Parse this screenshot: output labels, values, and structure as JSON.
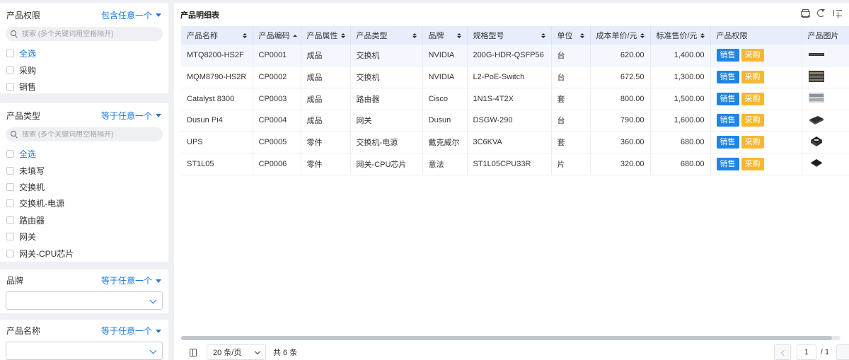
{
  "filters": {
    "permission": {
      "title": "产品权限",
      "operator": "包含任意一个",
      "search_placeholder": "搜索 (多个关键词用空格隔开)",
      "options": [
        "全选",
        "采购",
        "销售"
      ]
    },
    "type": {
      "title": "产品类型",
      "operator": "等于任意一个",
      "search_placeholder": "搜索 (多个关键词用空格隔开)",
      "options": [
        "全选",
        "未填写",
        "交换机",
        "交换机-电源",
        "路由器",
        "网关",
        "网关-CPU芯片"
      ]
    },
    "brand": {
      "title": "品牌",
      "operator": "等于任意一个",
      "value": ""
    },
    "name": {
      "title": "产品名称",
      "operator": "等于任意一个",
      "value": ""
    }
  },
  "table": {
    "title": "产品明细表",
    "columns": [
      "产品名称",
      "产品编码",
      "产品属性",
      "产品类型",
      "品牌",
      "规格型号",
      "单位",
      "成本单价/元",
      "标准售价/元",
      "产品权限",
      "产品图片"
    ],
    "permission_tags": {
      "sale": "销售",
      "buy": "采购"
    },
    "rows": [
      {
        "name": "MTQ8200-HS2F",
        "code": "CP0001",
        "attr": "成品",
        "type": "交换机",
        "brand": "NVIDIA",
        "spec": "200G-HDR-QSFP56",
        "unit": "台",
        "cost": "620.00",
        "price": "1,400.00",
        "image": "switch-thin-image"
      },
      {
        "name": "MQM8790-HS2R",
        "code": "CP0002",
        "attr": "成品",
        "type": "交换机",
        "brand": "NVIDIA",
        "spec": "L2-PoE-Switch",
        "unit": "台",
        "cost": "672.50",
        "price": "1,300.00",
        "image": "switch-ports-image"
      },
      {
        "name": "Catalyst 8300",
        "code": "CP0003",
        "attr": "成品",
        "type": "路由器",
        "brand": "Cisco",
        "spec": "1N1S-4T2X",
        "unit": "套",
        "cost": "800.00",
        "price": "1,500.00",
        "image": "router-image"
      },
      {
        "name": "Dusun Pi4",
        "code": "CP0004",
        "attr": "成品",
        "type": "网关",
        "brand": "Dusun",
        "spec": "DSGW-290",
        "unit": "台",
        "cost": "790.00",
        "price": "1,600.00",
        "image": "gateway-box-image"
      },
      {
        "name": "UPS",
        "code": "CP0005",
        "attr": "零件",
        "type": "交换机-电源",
        "brand": "戴克威尔",
        "spec": "3C6KVA",
        "unit": "套",
        "cost": "360.00",
        "price": "680.00",
        "image": "power-unit-image"
      },
      {
        "name": "ST1L05",
        "code": "CP0006",
        "attr": "零件",
        "type": "网关-CPU芯片",
        "brand": "意法",
        "spec": "ST1L05CPU33R",
        "unit": "片",
        "cost": "320.00",
        "price": "680.00",
        "image": "cpu-chip-image"
      }
    ]
  },
  "pager": {
    "page_size": "20 条/页",
    "total": "共 6 条",
    "current_page": "1",
    "page_count": "/ 1"
  },
  "icons": [
    "search-icon",
    "chevron-down-icon",
    "printer-icon",
    "refresh-icon",
    "sort-list-icon",
    "columns-icon",
    "chevron-left-icon"
  ]
}
